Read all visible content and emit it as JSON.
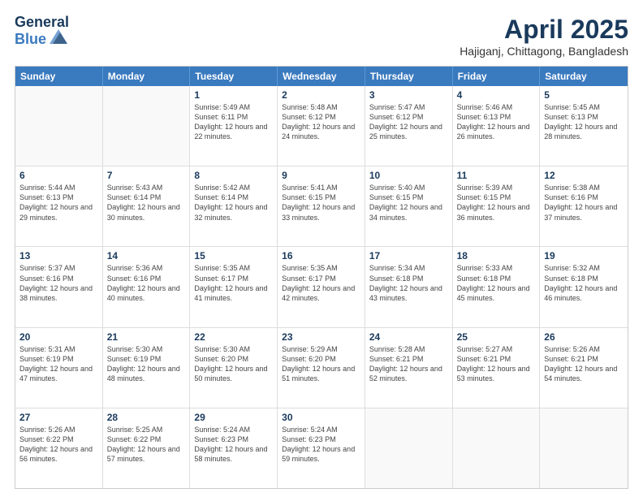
{
  "header": {
    "logo_general": "General",
    "logo_blue": "Blue",
    "month_title": "April 2025",
    "location": "Hajiganj, Chittagong, Bangladesh"
  },
  "day_headers": [
    "Sunday",
    "Monday",
    "Tuesday",
    "Wednesday",
    "Thursday",
    "Friday",
    "Saturday"
  ],
  "rows": [
    [
      {
        "day": "",
        "info": ""
      },
      {
        "day": "",
        "info": ""
      },
      {
        "day": "1",
        "info": "Sunrise: 5:49 AM\nSunset: 6:11 PM\nDaylight: 12 hours and 22 minutes."
      },
      {
        "day": "2",
        "info": "Sunrise: 5:48 AM\nSunset: 6:12 PM\nDaylight: 12 hours and 24 minutes."
      },
      {
        "day": "3",
        "info": "Sunrise: 5:47 AM\nSunset: 6:12 PM\nDaylight: 12 hours and 25 minutes."
      },
      {
        "day": "4",
        "info": "Sunrise: 5:46 AM\nSunset: 6:13 PM\nDaylight: 12 hours and 26 minutes."
      },
      {
        "day": "5",
        "info": "Sunrise: 5:45 AM\nSunset: 6:13 PM\nDaylight: 12 hours and 28 minutes."
      }
    ],
    [
      {
        "day": "6",
        "info": "Sunrise: 5:44 AM\nSunset: 6:13 PM\nDaylight: 12 hours and 29 minutes."
      },
      {
        "day": "7",
        "info": "Sunrise: 5:43 AM\nSunset: 6:14 PM\nDaylight: 12 hours and 30 minutes."
      },
      {
        "day": "8",
        "info": "Sunrise: 5:42 AM\nSunset: 6:14 PM\nDaylight: 12 hours and 32 minutes."
      },
      {
        "day": "9",
        "info": "Sunrise: 5:41 AM\nSunset: 6:15 PM\nDaylight: 12 hours and 33 minutes."
      },
      {
        "day": "10",
        "info": "Sunrise: 5:40 AM\nSunset: 6:15 PM\nDaylight: 12 hours and 34 minutes."
      },
      {
        "day": "11",
        "info": "Sunrise: 5:39 AM\nSunset: 6:15 PM\nDaylight: 12 hours and 36 minutes."
      },
      {
        "day": "12",
        "info": "Sunrise: 5:38 AM\nSunset: 6:16 PM\nDaylight: 12 hours and 37 minutes."
      }
    ],
    [
      {
        "day": "13",
        "info": "Sunrise: 5:37 AM\nSunset: 6:16 PM\nDaylight: 12 hours and 38 minutes."
      },
      {
        "day": "14",
        "info": "Sunrise: 5:36 AM\nSunset: 6:16 PM\nDaylight: 12 hours and 40 minutes."
      },
      {
        "day": "15",
        "info": "Sunrise: 5:35 AM\nSunset: 6:17 PM\nDaylight: 12 hours and 41 minutes."
      },
      {
        "day": "16",
        "info": "Sunrise: 5:35 AM\nSunset: 6:17 PM\nDaylight: 12 hours and 42 minutes."
      },
      {
        "day": "17",
        "info": "Sunrise: 5:34 AM\nSunset: 6:18 PM\nDaylight: 12 hours and 43 minutes."
      },
      {
        "day": "18",
        "info": "Sunrise: 5:33 AM\nSunset: 6:18 PM\nDaylight: 12 hours and 45 minutes."
      },
      {
        "day": "19",
        "info": "Sunrise: 5:32 AM\nSunset: 6:18 PM\nDaylight: 12 hours and 46 minutes."
      }
    ],
    [
      {
        "day": "20",
        "info": "Sunrise: 5:31 AM\nSunset: 6:19 PM\nDaylight: 12 hours and 47 minutes."
      },
      {
        "day": "21",
        "info": "Sunrise: 5:30 AM\nSunset: 6:19 PM\nDaylight: 12 hours and 48 minutes."
      },
      {
        "day": "22",
        "info": "Sunrise: 5:30 AM\nSunset: 6:20 PM\nDaylight: 12 hours and 50 minutes."
      },
      {
        "day": "23",
        "info": "Sunrise: 5:29 AM\nSunset: 6:20 PM\nDaylight: 12 hours and 51 minutes."
      },
      {
        "day": "24",
        "info": "Sunrise: 5:28 AM\nSunset: 6:21 PM\nDaylight: 12 hours and 52 minutes."
      },
      {
        "day": "25",
        "info": "Sunrise: 5:27 AM\nSunset: 6:21 PM\nDaylight: 12 hours and 53 minutes."
      },
      {
        "day": "26",
        "info": "Sunrise: 5:26 AM\nSunset: 6:21 PM\nDaylight: 12 hours and 54 minutes."
      }
    ],
    [
      {
        "day": "27",
        "info": "Sunrise: 5:26 AM\nSunset: 6:22 PM\nDaylight: 12 hours and 56 minutes."
      },
      {
        "day": "28",
        "info": "Sunrise: 5:25 AM\nSunset: 6:22 PM\nDaylight: 12 hours and 57 minutes."
      },
      {
        "day": "29",
        "info": "Sunrise: 5:24 AM\nSunset: 6:23 PM\nDaylight: 12 hours and 58 minutes."
      },
      {
        "day": "30",
        "info": "Sunrise: 5:24 AM\nSunset: 6:23 PM\nDaylight: 12 hours and 59 minutes."
      },
      {
        "day": "",
        "info": ""
      },
      {
        "day": "",
        "info": ""
      },
      {
        "day": "",
        "info": ""
      }
    ]
  ]
}
